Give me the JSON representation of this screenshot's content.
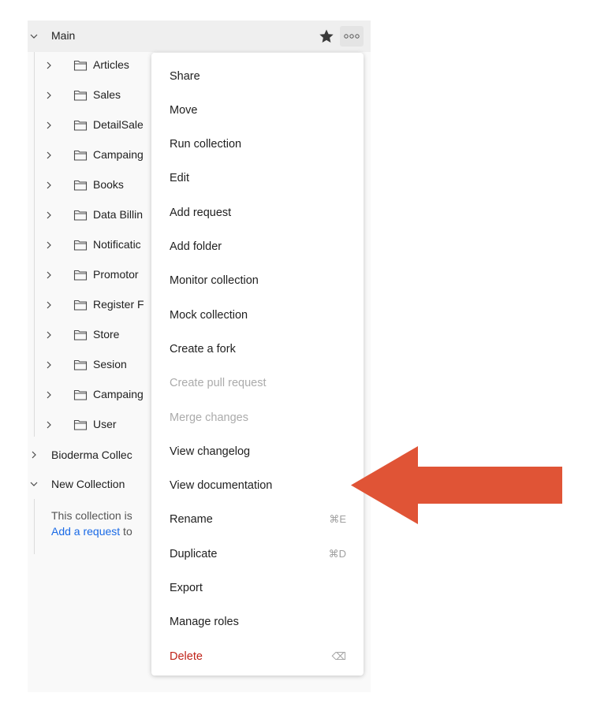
{
  "sidebar": {
    "main": {
      "label": "Main"
    },
    "folders": [
      {
        "label": "Articles"
      },
      {
        "label": "Sales"
      },
      {
        "label": "DetailSale"
      },
      {
        "label": "Campaing"
      },
      {
        "label": "Books"
      },
      {
        "label": "Data Billin"
      },
      {
        "label": "Notificatic"
      },
      {
        "label": "Promotor"
      },
      {
        "label": "Register F"
      },
      {
        "label": "Store"
      },
      {
        "label": "Sesion"
      },
      {
        "label": "Campaing"
      },
      {
        "label": "User"
      }
    ],
    "collections": [
      {
        "label": "Bioderma Collec"
      },
      {
        "label": "New Collection"
      }
    ],
    "empty_text": "This collection is",
    "empty_link": "Add a request",
    "empty_suffix": " to"
  },
  "menu": {
    "items": [
      {
        "label": "Share",
        "shortcut": "",
        "state": "normal"
      },
      {
        "label": "Move",
        "shortcut": "",
        "state": "normal"
      },
      {
        "label": "Run collection",
        "shortcut": "",
        "state": "normal"
      },
      {
        "label": "Edit",
        "shortcut": "",
        "state": "normal"
      },
      {
        "label": "Add request",
        "shortcut": "",
        "state": "normal"
      },
      {
        "label": "Add folder",
        "shortcut": "",
        "state": "normal"
      },
      {
        "label": "Monitor collection",
        "shortcut": "",
        "state": "normal"
      },
      {
        "label": "Mock collection",
        "shortcut": "",
        "state": "normal"
      },
      {
        "label": "Create a fork",
        "shortcut": "",
        "state": "normal"
      },
      {
        "label": "Create pull request",
        "shortcut": "",
        "state": "disabled"
      },
      {
        "label": "Merge changes",
        "shortcut": "",
        "state": "disabled"
      },
      {
        "label": "View changelog",
        "shortcut": "",
        "state": "normal"
      },
      {
        "label": "View documentation",
        "shortcut": "",
        "state": "normal"
      },
      {
        "label": "Rename",
        "shortcut": "⌘E",
        "state": "normal"
      },
      {
        "label": "Duplicate",
        "shortcut": "⌘D",
        "state": "normal"
      },
      {
        "label": "Export",
        "shortcut": "",
        "state": "normal"
      },
      {
        "label": "Manage roles",
        "shortcut": "",
        "state": "normal"
      },
      {
        "label": "Delete",
        "shortcut": "⌫",
        "state": "danger"
      }
    ]
  },
  "colors": {
    "arrow": "#e05436",
    "danger": "#c0241a",
    "link": "#1a6ae6"
  },
  "icons": [
    "chevron-down-icon",
    "chevron-right-icon",
    "folder-icon",
    "star-icon",
    "more-icon",
    "backspace-icon"
  ]
}
